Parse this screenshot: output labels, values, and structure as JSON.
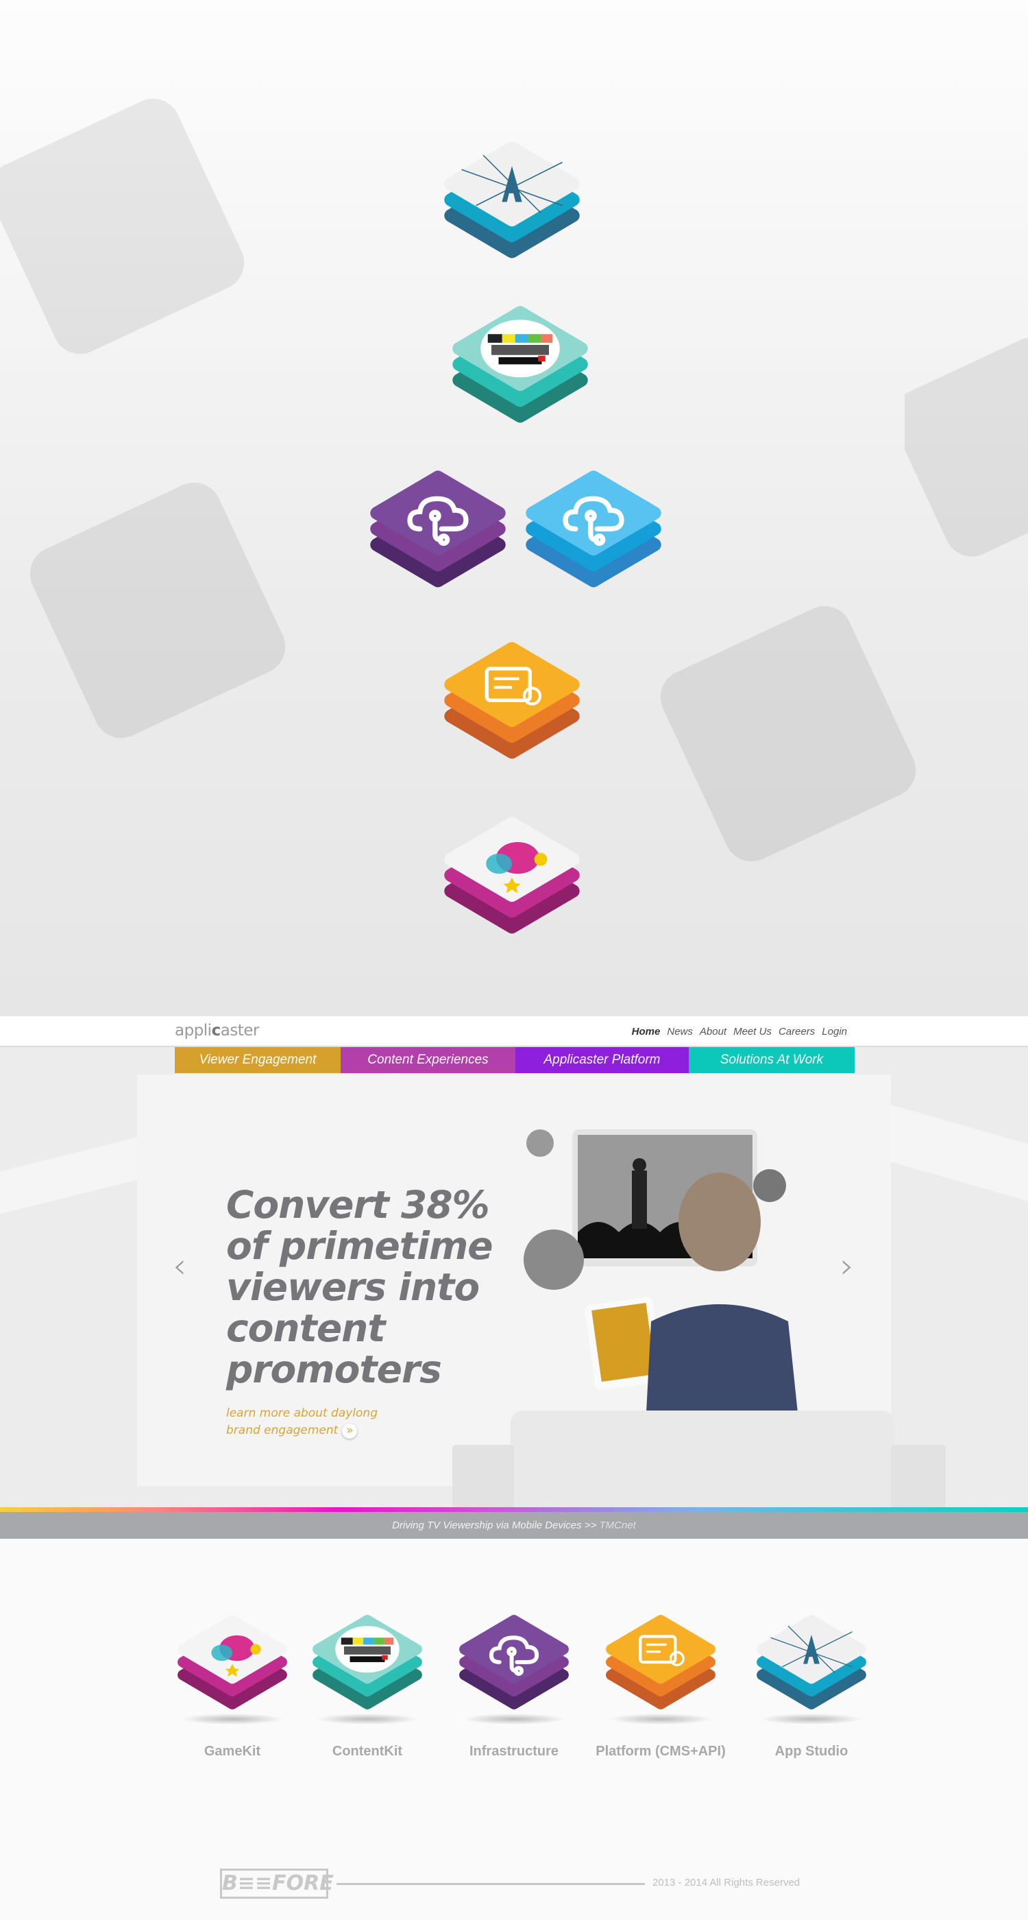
{
  "showcase": {
    "icons": [
      {
        "name": "app-studio",
        "glyph": "letter-a",
        "colors": [
          "#f0f0f0",
          "#12a5c8",
          "#2a6b8b"
        ]
      },
      {
        "name": "content-kit",
        "glyph": "tv-test-pattern",
        "colors": [
          "#8fd8d0",
          "#2bbfb3",
          "#228478"
        ]
      },
      {
        "name": "infrastructure-purple",
        "glyph": "cloud",
        "colors": [
          "#7b4a9c",
          "#7e3e94",
          "#4e2868"
        ]
      },
      {
        "name": "infrastructure-blue",
        "glyph": "cloud",
        "colors": [
          "#58c3f0",
          "#149fd8",
          "#2b85c6"
        ]
      },
      {
        "name": "platform",
        "glyph": "cms-card",
        "colors": [
          "#f7b026",
          "#ec7c26",
          "#c85c26"
        ]
      },
      {
        "name": "game-kit",
        "glyph": "bubbles",
        "colors": [
          "#f4f4f4",
          "#c02d8e",
          "#8e1f6a"
        ]
      }
    ]
  },
  "header": {
    "logo": {
      "pre": "appli",
      "mid": "c",
      "post": "aster"
    },
    "nav": [
      "Home",
      "News",
      "About",
      "Meet Us",
      "Careers",
      "Login"
    ]
  },
  "tabs": [
    {
      "label": "Viewer Engagement",
      "color": "#d6a02d"
    },
    {
      "label": "Content Experiences",
      "color": "#b33fab"
    },
    {
      "label": "Applicaster Platform",
      "color": "#8e1fdc"
    },
    {
      "label": "Solutions At Work",
      "color": "#0bc8bb"
    }
  ],
  "hero": {
    "headline": "Convert 38% of primetime viewers into content promoters",
    "link_line1": "learn more about daylong",
    "link_line2": "brand engagement",
    "link_arrow": "»",
    "prev": "‹",
    "next": "›"
  },
  "strip": {
    "text": "Driving TV Viewership via Mobile Devices >> ",
    "source": "TMCnet"
  },
  "products": [
    {
      "label": "GameKit",
      "glyph": "bubbles",
      "colors": [
        "#f4f4f4",
        "#c02d8e",
        "#8e1f6a"
      ]
    },
    {
      "label": "ContentKit",
      "glyph": "tv-test-pattern",
      "colors": [
        "#8fd8d0",
        "#2bbfb3",
        "#228478"
      ]
    },
    {
      "label": "Infrastructure",
      "glyph": "cloud",
      "colors": [
        "#7b4a9c",
        "#7e3e94",
        "#4e2868"
      ]
    },
    {
      "label": "Platform (CMS+API)",
      "glyph": "cms-card",
      "colors": [
        "#f7b026",
        "#ec7c26",
        "#c85c26"
      ]
    },
    {
      "label": "App Studio",
      "glyph": "letter-a",
      "colors": [
        "#f0f0f0",
        "#12a5c8",
        "#2a6b8b"
      ]
    }
  ],
  "footer": {
    "logo": "BEEFORE",
    "copyright": "2013 - 2014 All Rights Reserved"
  }
}
